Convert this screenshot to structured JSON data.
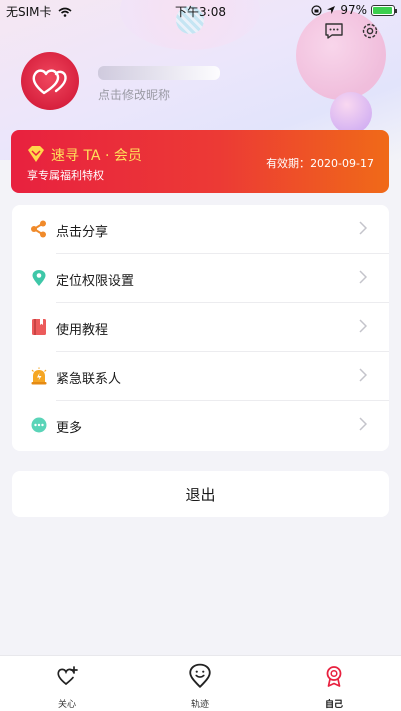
{
  "status_bar": {
    "carrier": "无SIM卡",
    "time": "下午3:08",
    "battery_percent": "97%",
    "battery_level": 0.97
  },
  "profile": {
    "nickname": "",
    "edit_hint": "点击修改昵称"
  },
  "vip_card": {
    "title": "速寻 TA · 会员",
    "subtitle": "享专属福利特权",
    "expiry_label": "有效期：",
    "expiry_date": "2020-09-17"
  },
  "menu": {
    "items": [
      {
        "label": "点击分享",
        "icon": "share-icon",
        "color": "#f08a2a"
      },
      {
        "label": "定位权限设置",
        "icon": "location-pin-icon",
        "color": "#3ec7a8"
      },
      {
        "label": "使用教程",
        "icon": "book-icon",
        "color": "#ec5b5b"
      },
      {
        "label": "紧急联系人",
        "icon": "alarm-icon",
        "color": "#f5a623"
      },
      {
        "label": "更多",
        "icon": "more-icon",
        "color": "#5ad4b8"
      }
    ]
  },
  "logout": {
    "label": "退出"
  },
  "tabbar": {
    "tabs": [
      {
        "label": "关心",
        "icon": "heart-plus-icon"
      },
      {
        "label": "轨迹",
        "icon": "track-icon"
      },
      {
        "label": "自己",
        "icon": "medal-icon",
        "active": true
      }
    ]
  },
  "colors": {
    "accent_red": "#e8213f",
    "accent_orange": "#f06a18",
    "vip_gold": "#ffe05a",
    "page_bg": "#f3f3f8"
  }
}
